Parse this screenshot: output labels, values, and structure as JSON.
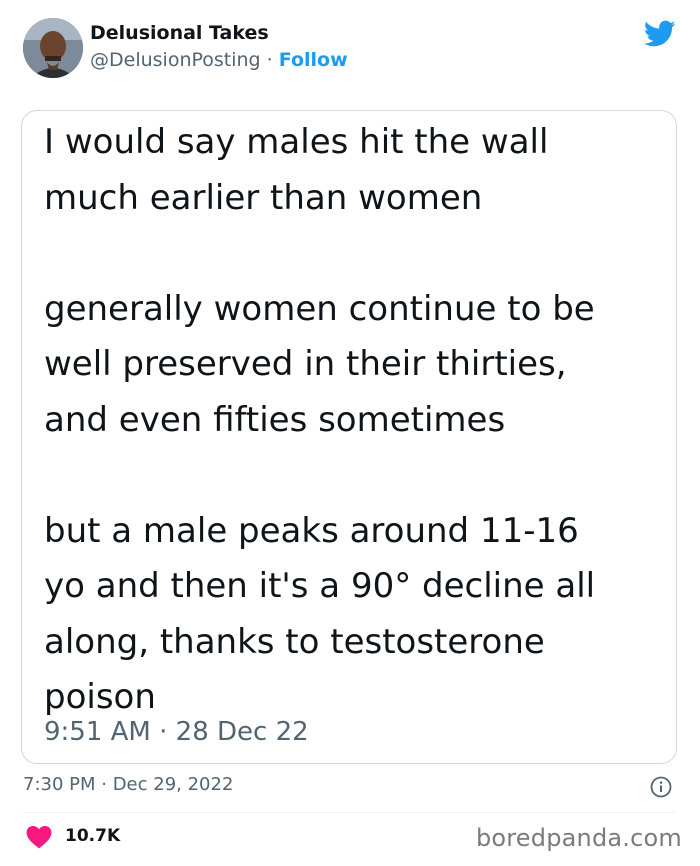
{
  "tweet": {
    "author_name": "Delusional Takes",
    "handle": "@DelusionPosting",
    "separator": " · ",
    "follow_label": "Follow",
    "timestamp": "7:30 PM · Dec 29, 2022",
    "likes": "10.7K"
  },
  "embedded_tweet": {
    "text": "I would say males hit the wall\nmuch earlier than women\n\ngenerally women continue to be\nwell preserved in their thirties,\nand even fifties sometimes\n\nbut a male peaks around 11-16\nyo and then it's a 90° decline all\nalong, thanks to testosterone\npoison",
    "time": "9:51 AM · 28 Dec 22"
  },
  "watermark": "boredpanda.com",
  "icons": {
    "brand": "twitter-bird-icon",
    "info": "info-icon",
    "like": "heart-icon"
  },
  "colors": {
    "link": "#1d9bf0",
    "heart": "#f91880",
    "muted": "#536471"
  }
}
